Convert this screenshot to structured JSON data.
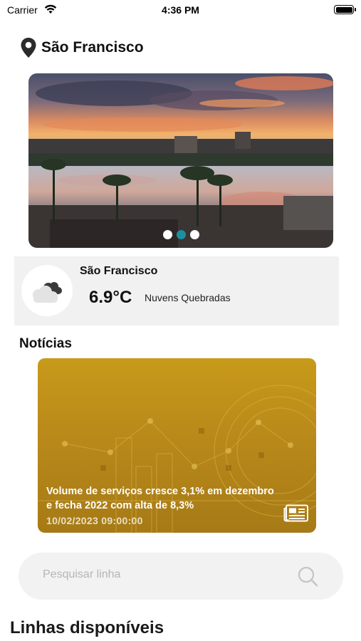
{
  "status_bar": {
    "carrier": "Carrier",
    "time": "4:36 PM",
    "wifi_icon": "wifi-icon",
    "battery_icon": "battery-icon"
  },
  "location": {
    "name": "São Francisco",
    "icon": "location-pin-icon"
  },
  "carousel": {
    "page_count": 3,
    "active_index": 1
  },
  "weather": {
    "city": "São Francisco",
    "temperature": "6.9°C",
    "description": "Nuvens Quebradas",
    "icon": "broken-clouds-icon"
  },
  "news": {
    "heading": "Notícias",
    "items": [
      {
        "title": "Volume de serviços cresce 3,1% em dezembro  e fecha 2022 com alta de 8,3%",
        "date": "10/02/2023 09:00:00",
        "icon": "newspaper-icon"
      }
    ]
  },
  "search": {
    "placeholder": "Pesquisar linha",
    "value": "",
    "icon": "search-icon"
  },
  "lines": {
    "heading": "Linhas disponíveis"
  },
  "colors": {
    "accent": "#1e8f9e",
    "news_card": "#b9891a",
    "weather_bg": "#f1f1f1",
    "search_bg": "#f2f2f2"
  }
}
